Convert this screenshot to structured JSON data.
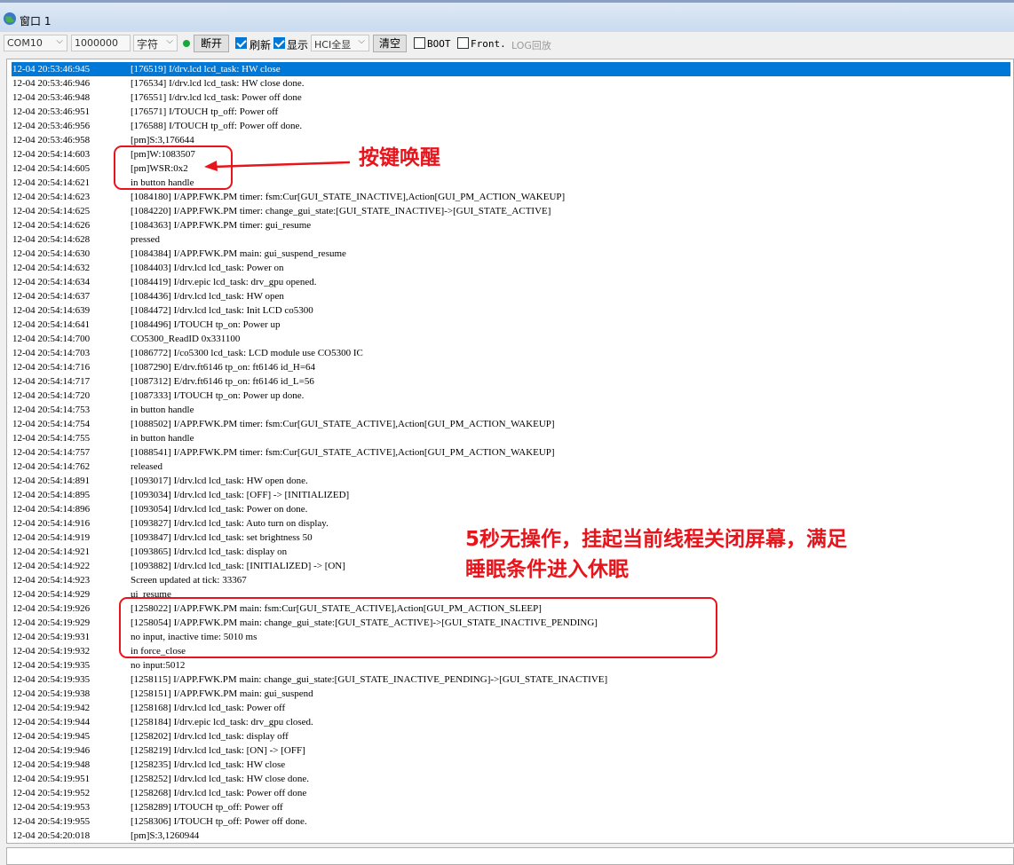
{
  "window": {
    "title": "窗口 1"
  },
  "toolbar": {
    "port": "COM10",
    "baud": "1000000",
    "format": "字符",
    "disconnect_label": "断开",
    "refresh_label": "刷新",
    "display_label": "显示",
    "hci_mode": "HCI全显",
    "clear_label": "清空",
    "boot_label": "BOOT",
    "front_label": "Front.",
    "log_replay_label": "LOG回放"
  },
  "log_lines": [
    {
      "time": "12-04 20:53:46:945",
      "msg": "[176519] I/drv.lcd lcd_task: HW close"
    },
    {
      "time": "12-04 20:53:46:946",
      "msg": "[176534] I/drv.lcd lcd_task: HW close done."
    },
    {
      "time": "12-04 20:53:46:948",
      "msg": "[176551] I/drv.lcd lcd_task: Power off done"
    },
    {
      "time": "12-04 20:53:46:951",
      "msg": "[176571] I/TOUCH tp_off: Power off"
    },
    {
      "time": "12-04 20:53:46:956",
      "msg": "[176588] I/TOUCH tp_off: Power off done."
    },
    {
      "time": "12-04 20:53:46:958",
      "msg": "[pm]S:3,176644"
    },
    {
      "time": "12-04 20:54:14:603",
      "msg": "[pm]W:1083507"
    },
    {
      "time": "12-04 20:54:14:605",
      "msg": "[pm]WSR:0x2"
    },
    {
      "time": "12-04 20:54:14:621",
      "msg": "in button handle"
    },
    {
      "time": "12-04 20:54:14:623",
      "msg": "[1084180] I/APP.FWK.PM timer: fsm:Cur[GUI_STATE_INACTIVE],Action[GUI_PM_ACTION_WAKEUP]"
    },
    {
      "time": "12-04 20:54:14:625",
      "msg": "[1084220] I/APP.FWK.PM timer: change_gui_state:[GUI_STATE_INACTIVE]->[GUI_STATE_ACTIVE]"
    },
    {
      "time": "12-04 20:54:14:626",
      "msg": "[1084363] I/APP.FWK.PM timer: gui_resume"
    },
    {
      "time": "12-04 20:54:14:628",
      "msg": "pressed"
    },
    {
      "time": "12-04 20:54:14:630",
      "msg": "[1084384] I/APP.FWK.PM main: gui_suspend_resume"
    },
    {
      "time": "12-04 20:54:14:632",
      "msg": "[1084403] I/drv.lcd lcd_task: Power on"
    },
    {
      "time": "12-04 20:54:14:634",
      "msg": "[1084419] I/drv.epic lcd_task: drv_gpu opened."
    },
    {
      "time": "12-04 20:54:14:637",
      "msg": "[1084436] I/drv.lcd lcd_task: HW open"
    },
    {
      "time": "12-04 20:54:14:639",
      "msg": "[1084472] I/drv.lcd lcd_task: Init LCD co5300"
    },
    {
      "time": "12-04 20:54:14:641",
      "msg": "[1084496] I/TOUCH tp_on: Power up"
    },
    {
      "time": "12-04 20:54:14:700",
      "msg": "CO5300_ReadID 0x331100"
    },
    {
      "time": "12-04 20:54:14:703",
      "msg": "[1086772] I/co5300 lcd_task: LCD module use CO5300 IC"
    },
    {
      "time": "12-04 20:54:14:716",
      "msg": "[1087290] E/drv.ft6146 tp_on: ft6146 id_H=64"
    },
    {
      "time": "12-04 20:54:14:717",
      "msg": "[1087312] E/drv.ft6146 tp_on: ft6146 id_L=56"
    },
    {
      "time": "12-04 20:54:14:720",
      "msg": "[1087333] I/TOUCH tp_on: Power up done."
    },
    {
      "time": "12-04 20:54:14:753",
      "msg": "in button handle"
    },
    {
      "time": "12-04 20:54:14:754",
      "msg": "[1088502] I/APP.FWK.PM timer: fsm:Cur[GUI_STATE_ACTIVE],Action[GUI_PM_ACTION_WAKEUP]"
    },
    {
      "time": "12-04 20:54:14:755",
      "msg": "in button handle"
    },
    {
      "time": "12-04 20:54:14:757",
      "msg": "[1088541] I/APP.FWK.PM timer: fsm:Cur[GUI_STATE_ACTIVE],Action[GUI_PM_ACTION_WAKEUP]"
    },
    {
      "time": "12-04 20:54:14:762",
      "msg": "released"
    },
    {
      "time": "12-04 20:54:14:891",
      "msg": "[1093017] I/drv.lcd lcd_task: HW open done."
    },
    {
      "time": "12-04 20:54:14:895",
      "msg": "[1093034] I/drv.lcd lcd_task: [OFF] -> [INITIALIZED]"
    },
    {
      "time": "12-04 20:54:14:896",
      "msg": "[1093054] I/drv.lcd lcd_task: Power on done."
    },
    {
      "time": "12-04 20:54:14:916",
      "msg": "[1093827] I/drv.lcd lcd_task: Auto turn on display."
    },
    {
      "time": "12-04 20:54:14:919",
      "msg": "[1093847] I/drv.lcd lcd_task: set brightness 50"
    },
    {
      "time": "12-04 20:54:14:921",
      "msg": "[1093865] I/drv.lcd lcd_task: display on"
    },
    {
      "time": "12-04 20:54:14:922",
      "msg": "[1093882] I/drv.lcd lcd_task: [INITIALIZED] -> [ON]"
    },
    {
      "time": "12-04 20:54:14:923",
      "msg": "Screen updated at tick: 33367"
    },
    {
      "time": "12-04 20:54:14:929",
      "msg": "ui_resume"
    },
    {
      "time": "12-04 20:54:19:926",
      "msg": "[1258022] I/APP.FWK.PM main: fsm:Cur[GUI_STATE_ACTIVE],Action[GUI_PM_ACTION_SLEEP]"
    },
    {
      "time": "12-04 20:54:19:929",
      "msg": "[1258054] I/APP.FWK.PM main: change_gui_state:[GUI_STATE_ACTIVE]->[GUI_STATE_INACTIVE_PENDING]"
    },
    {
      "time": "12-04 20:54:19:931",
      "msg": "no input, inactive time: 5010 ms"
    },
    {
      "time": "12-04 20:54:19:932",
      "msg": "in force_close"
    },
    {
      "time": "12-04 20:54:19:935",
      "msg": "no input:5012"
    },
    {
      "time": "12-04 20:54:19:935",
      "msg": "[1258115] I/APP.FWK.PM main: change_gui_state:[GUI_STATE_INACTIVE_PENDING]->[GUI_STATE_INACTIVE]"
    },
    {
      "time": "12-04 20:54:19:938",
      "msg": "[1258151] I/APP.FWK.PM main: gui_suspend"
    },
    {
      "time": "12-04 20:54:19:942",
      "msg": "[1258168] I/drv.lcd lcd_task: Power off"
    },
    {
      "time": "12-04 20:54:19:944",
      "msg": "[1258184] I/drv.epic lcd_task: drv_gpu closed."
    },
    {
      "time": "12-04 20:54:19:945",
      "msg": "[1258202] I/drv.lcd lcd_task: display off"
    },
    {
      "time": "12-04 20:54:19:946",
      "msg": "[1258219] I/drv.lcd lcd_task: [ON] -> [OFF]"
    },
    {
      "time": "12-04 20:54:19:948",
      "msg": "[1258235] I/drv.lcd lcd_task: HW close"
    },
    {
      "time": "12-04 20:54:19:951",
      "msg": "[1258252] I/drv.lcd lcd_task: HW close done."
    },
    {
      "time": "12-04 20:54:19:952",
      "msg": "[1258268] I/drv.lcd lcd_task: Power off done"
    },
    {
      "time": "12-04 20:54:19:953",
      "msg": "[1258289] I/TOUCH tp_off: Power off"
    },
    {
      "time": "12-04 20:54:19:955",
      "msg": "[1258306] I/TOUCH tp_off: Power off done."
    },
    {
      "time": "12-04 20:54:20:018",
      "msg": "[pm]S:3,1260944"
    }
  ],
  "annotations": {
    "wake_note": "按键唤醒",
    "sleep_note_line1": "5秒无操作，挂起当前线程关闭屏幕，满足",
    "sleep_note_line2": "睡眠条件进入休眠"
  },
  "colors": {
    "accent": "#0078d7",
    "annotation": "#e8141b",
    "connected_dot": "#18a83a"
  }
}
